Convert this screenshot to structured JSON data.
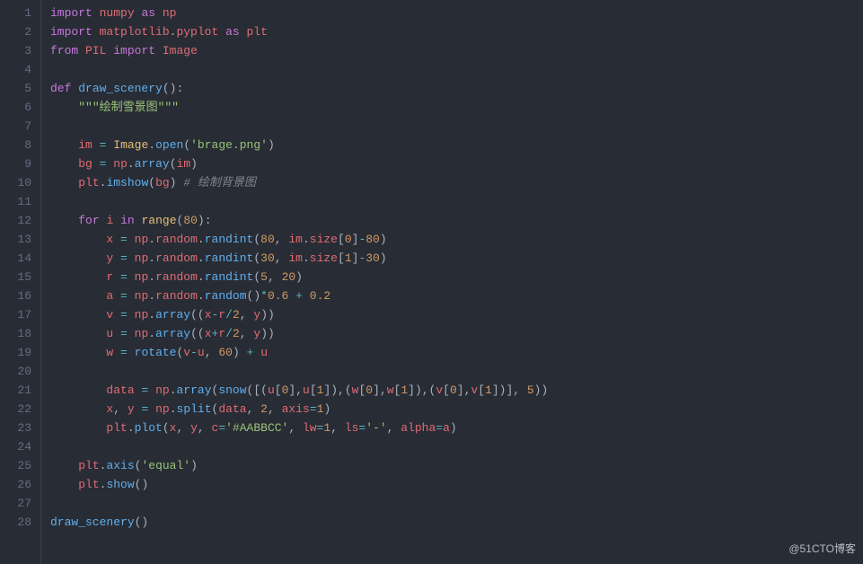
{
  "editor": {
    "line_count": 28,
    "lines": [
      {
        "n": 1,
        "tokens": [
          [
            "kw",
            "import"
          ],
          [
            "def",
            " "
          ],
          [
            "ident",
            "numpy"
          ],
          [
            "def",
            " "
          ],
          [
            "kw",
            "as"
          ],
          [
            "def",
            " "
          ],
          [
            "ident",
            "np"
          ]
        ]
      },
      {
        "n": 2,
        "tokens": [
          [
            "kw",
            "import"
          ],
          [
            "def",
            " "
          ],
          [
            "ident",
            "matplotlib"
          ],
          [
            "dot",
            "."
          ],
          [
            "ident",
            "pyplot"
          ],
          [
            "def",
            " "
          ],
          [
            "kw",
            "as"
          ],
          [
            "def",
            " "
          ],
          [
            "ident",
            "plt"
          ]
        ]
      },
      {
        "n": 3,
        "tokens": [
          [
            "kw",
            "from"
          ],
          [
            "def",
            " "
          ],
          [
            "ident",
            "PIL"
          ],
          [
            "def",
            " "
          ],
          [
            "kw",
            "import"
          ],
          [
            "def",
            " "
          ],
          [
            "ident",
            "Image"
          ]
        ]
      },
      {
        "n": 4,
        "tokens": []
      },
      {
        "n": 5,
        "tokens": [
          [
            "kw",
            "def"
          ],
          [
            "def",
            " "
          ],
          [
            "fn",
            "draw_scenery"
          ],
          [
            "punc",
            "():"
          ]
        ]
      },
      {
        "n": 6,
        "tokens": [
          [
            "def",
            "    "
          ],
          [
            "str",
            "\"\"\"绘制雪景图\"\"\""
          ]
        ]
      },
      {
        "n": 7,
        "tokens": []
      },
      {
        "n": 8,
        "tokens": [
          [
            "def",
            "    "
          ],
          [
            "ident",
            "im"
          ],
          [
            "def",
            " "
          ],
          [
            "op",
            "="
          ],
          [
            "def",
            " "
          ],
          [
            "builtin",
            "Image"
          ],
          [
            "dot",
            "."
          ],
          [
            "attr",
            "open"
          ],
          [
            "punc",
            "("
          ],
          [
            "str",
            "'brage.png'"
          ],
          [
            "punc",
            ")"
          ]
        ]
      },
      {
        "n": 9,
        "tokens": [
          [
            "def",
            "    "
          ],
          [
            "ident",
            "bg"
          ],
          [
            "def",
            " "
          ],
          [
            "op",
            "="
          ],
          [
            "def",
            " "
          ],
          [
            "ident",
            "np"
          ],
          [
            "dot",
            "."
          ],
          [
            "attr",
            "array"
          ],
          [
            "punc",
            "("
          ],
          [
            "ident",
            "im"
          ],
          [
            "punc",
            ")"
          ]
        ]
      },
      {
        "n": 10,
        "tokens": [
          [
            "def",
            "    "
          ],
          [
            "ident",
            "plt"
          ],
          [
            "dot",
            "."
          ],
          [
            "attr",
            "imshow"
          ],
          [
            "punc",
            "("
          ],
          [
            "ident",
            "bg"
          ],
          [
            "punc",
            ")"
          ],
          [
            "def",
            " "
          ],
          [
            "cmt",
            "# 绘制背景图"
          ]
        ]
      },
      {
        "n": 11,
        "tokens": []
      },
      {
        "n": 12,
        "tokens": [
          [
            "def",
            "    "
          ],
          [
            "kw",
            "for"
          ],
          [
            "def",
            " "
          ],
          [
            "ident",
            "i"
          ],
          [
            "def",
            " "
          ],
          [
            "kw",
            "in"
          ],
          [
            "def",
            " "
          ],
          [
            "builtin",
            "range"
          ],
          [
            "punc",
            "("
          ],
          [
            "num",
            "80"
          ],
          [
            "punc",
            "):"
          ]
        ]
      },
      {
        "n": 13,
        "tokens": [
          [
            "def",
            "        "
          ],
          [
            "ident",
            "x"
          ],
          [
            "def",
            " "
          ],
          [
            "op",
            "="
          ],
          [
            "def",
            " "
          ],
          [
            "ident",
            "np"
          ],
          [
            "dot",
            "."
          ],
          [
            "ident",
            "random"
          ],
          [
            "dot",
            "."
          ],
          [
            "attr",
            "randint"
          ],
          [
            "punc",
            "("
          ],
          [
            "num",
            "80"
          ],
          [
            "punc",
            ", "
          ],
          [
            "ident",
            "im"
          ],
          [
            "dot",
            "."
          ],
          [
            "ident",
            "size"
          ],
          [
            "punc",
            "["
          ],
          [
            "num",
            "0"
          ],
          [
            "punc",
            "]"
          ],
          [
            "op",
            "-"
          ],
          [
            "num",
            "80"
          ],
          [
            "punc",
            ")"
          ]
        ]
      },
      {
        "n": 14,
        "tokens": [
          [
            "def",
            "        "
          ],
          [
            "ident",
            "y"
          ],
          [
            "def",
            " "
          ],
          [
            "op",
            "="
          ],
          [
            "def",
            " "
          ],
          [
            "ident",
            "np"
          ],
          [
            "dot",
            "."
          ],
          [
            "ident",
            "random"
          ],
          [
            "dot",
            "."
          ],
          [
            "attr",
            "randint"
          ],
          [
            "punc",
            "("
          ],
          [
            "num",
            "30"
          ],
          [
            "punc",
            ", "
          ],
          [
            "ident",
            "im"
          ],
          [
            "dot",
            "."
          ],
          [
            "ident",
            "size"
          ],
          [
            "punc",
            "["
          ],
          [
            "num",
            "1"
          ],
          [
            "punc",
            "]"
          ],
          [
            "op",
            "-"
          ],
          [
            "num",
            "30"
          ],
          [
            "punc",
            ")"
          ]
        ]
      },
      {
        "n": 15,
        "tokens": [
          [
            "def",
            "        "
          ],
          [
            "ident",
            "r"
          ],
          [
            "def",
            " "
          ],
          [
            "op",
            "="
          ],
          [
            "def",
            " "
          ],
          [
            "ident",
            "np"
          ],
          [
            "dot",
            "."
          ],
          [
            "ident",
            "random"
          ],
          [
            "dot",
            "."
          ],
          [
            "attr",
            "randint"
          ],
          [
            "punc",
            "("
          ],
          [
            "num",
            "5"
          ],
          [
            "punc",
            ", "
          ],
          [
            "num",
            "20"
          ],
          [
            "punc",
            ")"
          ]
        ]
      },
      {
        "n": 16,
        "tokens": [
          [
            "def",
            "        "
          ],
          [
            "ident",
            "a"
          ],
          [
            "def",
            " "
          ],
          [
            "op",
            "="
          ],
          [
            "def",
            " "
          ],
          [
            "ident",
            "np"
          ],
          [
            "dot",
            "."
          ],
          [
            "ident",
            "random"
          ],
          [
            "dot",
            "."
          ],
          [
            "attr",
            "random"
          ],
          [
            "punc",
            "()"
          ],
          [
            "op",
            "*"
          ],
          [
            "num",
            "0.6"
          ],
          [
            "def",
            " "
          ],
          [
            "op",
            "+"
          ],
          [
            "def",
            " "
          ],
          [
            "num",
            "0.2"
          ]
        ]
      },
      {
        "n": 17,
        "tokens": [
          [
            "def",
            "        "
          ],
          [
            "ident",
            "v"
          ],
          [
            "def",
            " "
          ],
          [
            "op",
            "="
          ],
          [
            "def",
            " "
          ],
          [
            "ident",
            "np"
          ],
          [
            "dot",
            "."
          ],
          [
            "attr",
            "array"
          ],
          [
            "punc",
            "(("
          ],
          [
            "ident",
            "x"
          ],
          [
            "op",
            "-"
          ],
          [
            "ident",
            "r"
          ],
          [
            "op",
            "/"
          ],
          [
            "num",
            "2"
          ],
          [
            "punc",
            ", "
          ],
          [
            "ident",
            "y"
          ],
          [
            "punc",
            "))"
          ]
        ]
      },
      {
        "n": 18,
        "tokens": [
          [
            "def",
            "        "
          ],
          [
            "ident",
            "u"
          ],
          [
            "def",
            " "
          ],
          [
            "op",
            "="
          ],
          [
            "def",
            " "
          ],
          [
            "ident",
            "np"
          ],
          [
            "dot",
            "."
          ],
          [
            "attr",
            "array"
          ],
          [
            "punc",
            "(("
          ],
          [
            "ident",
            "x"
          ],
          [
            "op",
            "+"
          ],
          [
            "ident",
            "r"
          ],
          [
            "op",
            "/"
          ],
          [
            "num",
            "2"
          ],
          [
            "punc",
            ", "
          ],
          [
            "ident",
            "y"
          ],
          [
            "punc",
            "))"
          ]
        ]
      },
      {
        "n": 19,
        "tokens": [
          [
            "def",
            "        "
          ],
          [
            "ident",
            "w"
          ],
          [
            "def",
            " "
          ],
          [
            "op",
            "="
          ],
          [
            "def",
            " "
          ],
          [
            "attr",
            "rotate"
          ],
          [
            "punc",
            "("
          ],
          [
            "ident",
            "v"
          ],
          [
            "op",
            "-"
          ],
          [
            "ident",
            "u"
          ],
          [
            "punc",
            ", "
          ],
          [
            "num",
            "60"
          ],
          [
            "punc",
            ")"
          ],
          [
            "def",
            " "
          ],
          [
            "op",
            "+"
          ],
          [
            "def",
            " "
          ],
          [
            "ident",
            "u"
          ]
        ]
      },
      {
        "n": 20,
        "tokens": []
      },
      {
        "n": 21,
        "tokens": [
          [
            "def",
            "        "
          ],
          [
            "ident",
            "data"
          ],
          [
            "def",
            " "
          ],
          [
            "op",
            "="
          ],
          [
            "def",
            " "
          ],
          [
            "ident",
            "np"
          ],
          [
            "dot",
            "."
          ],
          [
            "attr",
            "array"
          ],
          [
            "punc",
            "("
          ],
          [
            "attr",
            "snow"
          ],
          [
            "punc",
            "([("
          ],
          [
            "ident",
            "u"
          ],
          [
            "punc",
            "["
          ],
          [
            "num",
            "0"
          ],
          [
            "punc",
            "],"
          ],
          [
            "ident",
            "u"
          ],
          [
            "punc",
            "["
          ],
          [
            "num",
            "1"
          ],
          [
            "punc",
            "]),("
          ],
          [
            "ident",
            "w"
          ],
          [
            "punc",
            "["
          ],
          [
            "num",
            "0"
          ],
          [
            "punc",
            "],"
          ],
          [
            "ident",
            "w"
          ],
          [
            "punc",
            "["
          ],
          [
            "num",
            "1"
          ],
          [
            "punc",
            "]),("
          ],
          [
            "ident",
            "v"
          ],
          [
            "punc",
            "["
          ],
          [
            "num",
            "0"
          ],
          [
            "punc",
            "],"
          ],
          [
            "ident",
            "v"
          ],
          [
            "punc",
            "["
          ],
          [
            "num",
            "1"
          ],
          [
            "punc",
            "])], "
          ],
          [
            "num",
            "5"
          ],
          [
            "punc",
            "))"
          ]
        ]
      },
      {
        "n": 22,
        "tokens": [
          [
            "def",
            "        "
          ],
          [
            "ident",
            "x"
          ],
          [
            "punc",
            ", "
          ],
          [
            "ident",
            "y"
          ],
          [
            "def",
            " "
          ],
          [
            "op",
            "="
          ],
          [
            "def",
            " "
          ],
          [
            "ident",
            "np"
          ],
          [
            "dot",
            "."
          ],
          [
            "attr",
            "split"
          ],
          [
            "punc",
            "("
          ],
          [
            "ident",
            "data"
          ],
          [
            "punc",
            ", "
          ],
          [
            "num",
            "2"
          ],
          [
            "punc",
            ", "
          ],
          [
            "ident",
            "axis"
          ],
          [
            "op",
            "="
          ],
          [
            "num",
            "1"
          ],
          [
            "punc",
            ")"
          ]
        ]
      },
      {
        "n": 23,
        "tokens": [
          [
            "def",
            "        "
          ],
          [
            "ident",
            "plt"
          ],
          [
            "dot",
            "."
          ],
          [
            "attr",
            "plot"
          ],
          [
            "punc",
            "("
          ],
          [
            "ident",
            "x"
          ],
          [
            "punc",
            ", "
          ],
          [
            "ident",
            "y"
          ],
          [
            "punc",
            ", "
          ],
          [
            "ident",
            "c"
          ],
          [
            "op",
            "="
          ],
          [
            "str",
            "'#AABBCC'"
          ],
          [
            "punc",
            ", "
          ],
          [
            "ident",
            "lw"
          ],
          [
            "op",
            "="
          ],
          [
            "num",
            "1"
          ],
          [
            "punc",
            ", "
          ],
          [
            "ident",
            "ls"
          ],
          [
            "op",
            "="
          ],
          [
            "str",
            "'-'"
          ],
          [
            "punc",
            ", "
          ],
          [
            "ident",
            "alpha"
          ],
          [
            "op",
            "="
          ],
          [
            "ident",
            "a"
          ],
          [
            "punc",
            ")"
          ]
        ]
      },
      {
        "n": 24,
        "tokens": []
      },
      {
        "n": 25,
        "tokens": [
          [
            "def",
            "    "
          ],
          [
            "ident",
            "plt"
          ],
          [
            "dot",
            "."
          ],
          [
            "attr",
            "axis"
          ],
          [
            "punc",
            "("
          ],
          [
            "str",
            "'equal'"
          ],
          [
            "punc",
            ")"
          ]
        ]
      },
      {
        "n": 26,
        "tokens": [
          [
            "def",
            "    "
          ],
          [
            "ident",
            "plt"
          ],
          [
            "dot",
            "."
          ],
          [
            "attr",
            "show"
          ],
          [
            "punc",
            "()"
          ]
        ]
      },
      {
        "n": 27,
        "tokens": []
      },
      {
        "n": 28,
        "tokens": [
          [
            "attr",
            "draw_scenery"
          ],
          [
            "punc",
            "()"
          ]
        ]
      }
    ]
  },
  "watermark": "@51CTO博客"
}
